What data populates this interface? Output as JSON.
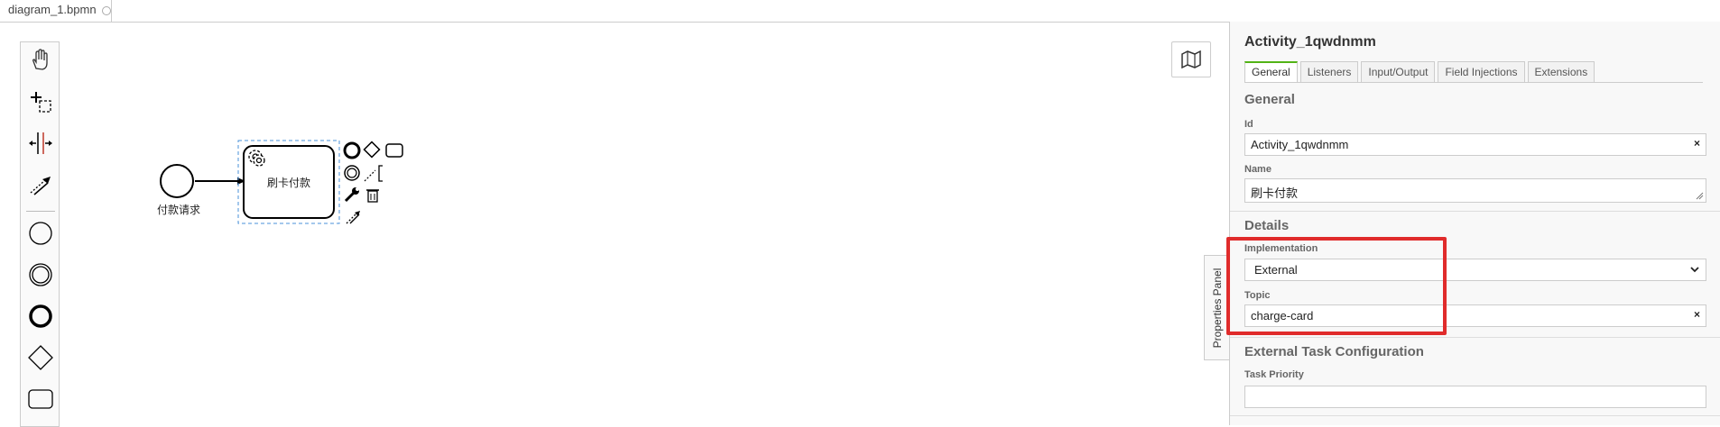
{
  "file_tab": {
    "name": "diagram_1.bpmn"
  },
  "palette": {
    "tools": [
      {
        "icon": "hand-tool-icon"
      },
      {
        "icon": "lasso-tool-icon"
      },
      {
        "icon": "space-tool-icon"
      },
      {
        "icon": "global-connect-tool-icon"
      },
      {
        "icon": "start-event-icon"
      },
      {
        "icon": "intermediate-event-icon"
      },
      {
        "icon": "end-event-icon"
      },
      {
        "icon": "gateway-icon"
      },
      {
        "icon": "task-icon"
      }
    ]
  },
  "diagram": {
    "start_event_label": "付款请求",
    "task_label": "刷卡付款",
    "task_type_icon": "service-task-gear-icon",
    "context_pad_icons": [
      "end-event-icon",
      "gateway-icon",
      "task-icon",
      "intermediate-event-icon",
      "text-annotation-icon",
      "wrench-icon",
      "trash-icon",
      "connect-icon"
    ]
  },
  "minimap": {
    "icon": "map-icon"
  },
  "panel_toggle": {
    "label": "Properties Panel"
  },
  "properties": {
    "title": "Activity_1qwdnmm",
    "tabs": [
      "General",
      "Listeners",
      "Input/Output",
      "Field Injections",
      "Extensions"
    ],
    "active_tab": "General",
    "general": {
      "title": "General",
      "id_label": "Id",
      "id_value": "Activity_1qwdnmm",
      "name_label": "Name",
      "name_value": "刷卡付款"
    },
    "details": {
      "title": "Details",
      "implementation_label": "Implementation",
      "implementation_value": "External",
      "topic_label": "Topic",
      "topic_value": "charge-card"
    },
    "external": {
      "title": "External Task Configuration",
      "priority_label": "Task Priority",
      "priority_value": ""
    },
    "clear_symbol": "×"
  },
  "colors": {
    "highlight": "#e02b2b",
    "active_tab": "#52b415",
    "selection": "#4a90d9"
  }
}
